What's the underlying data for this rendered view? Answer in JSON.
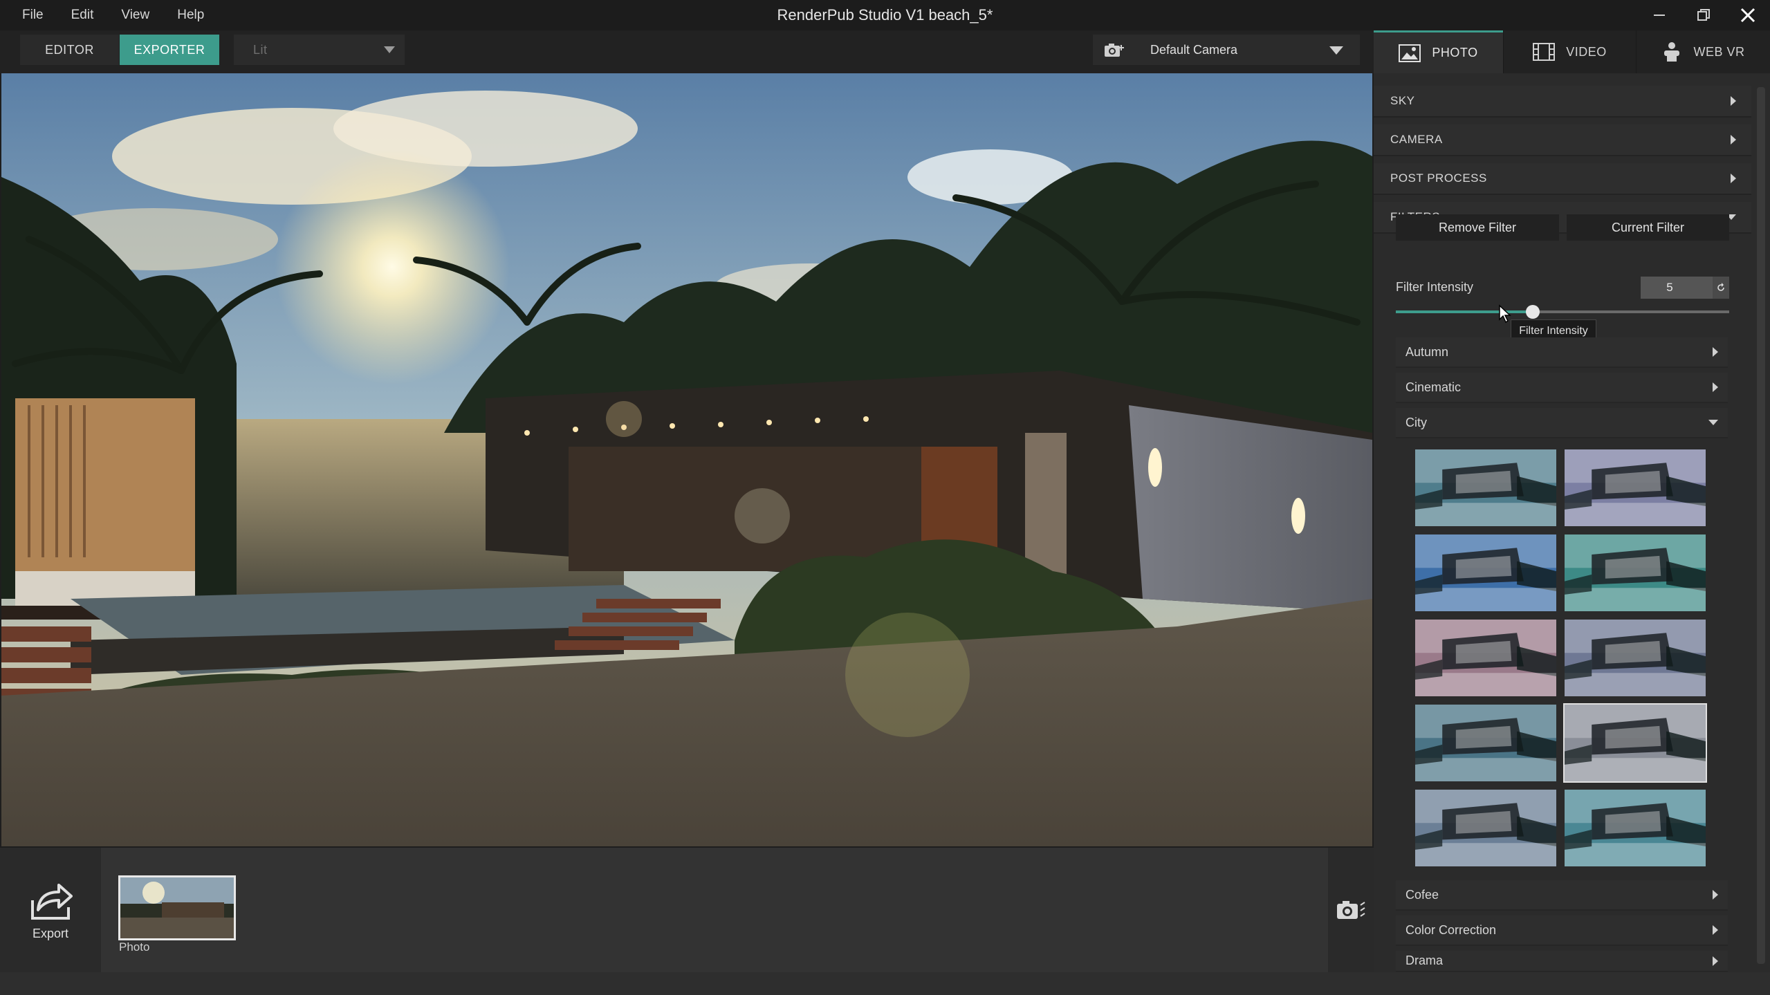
{
  "window": {
    "title": "RenderPub Studio V1  beach_5*",
    "menu": [
      "File",
      "Edit",
      "View",
      "Help"
    ]
  },
  "toolbar": {
    "editor_label": "EDITOR",
    "exporter_label": "EXPORTER",
    "render_mode": "Lit",
    "camera": "Default Camera"
  },
  "panel": {
    "tabs": [
      {
        "label": "PHOTO",
        "icon": "image-icon",
        "active": true
      },
      {
        "label": "VIDEO",
        "icon": "film-icon",
        "active": false
      },
      {
        "label": "WEB VR",
        "icon": "vr-viewer-icon",
        "active": false
      }
    ],
    "sections": {
      "sky": "SKY",
      "camera": "CAMERA",
      "post_process": "POST PROCESS",
      "filters": "FILTERS"
    },
    "filters": {
      "remove_label": "Remove Filter",
      "current_label": "Current Filter",
      "intensity_label": "Filter Intensity",
      "intensity_value": "5",
      "intensity_fraction": 0.41,
      "tooltip": "Filter Intensity",
      "categories": [
        "Autumn",
        "Cinematic",
        "City",
        "Cofee",
        "Color Correction",
        "Drama"
      ],
      "expanded_category": "City",
      "city_thumbs": [
        {
          "tint": "#4f7d8c",
          "selected": false
        },
        {
          "tint": "#7c7fa3",
          "selected": false
        },
        {
          "tint": "#3e6fa8",
          "selected": false
        },
        {
          "tint": "#3d8a86",
          "selected": false
        },
        {
          "tint": "#9a7a8a",
          "selected": false
        },
        {
          "tint": "#6f7894",
          "selected": false
        },
        {
          "tint": "#4a7486",
          "selected": false
        },
        {
          "tint": "#8a8e98",
          "selected": true
        },
        {
          "tint": "#6b7f96",
          "selected": false
        },
        {
          "tint": "#4a8794",
          "selected": false
        }
      ]
    }
  },
  "bottom": {
    "export_label": "Export",
    "thumb_label": "Photo"
  },
  "colors": {
    "accent": "#3d9c8c",
    "panel_bg": "#2b2b2b",
    "titlebar_bg": "#1c1c1c"
  }
}
